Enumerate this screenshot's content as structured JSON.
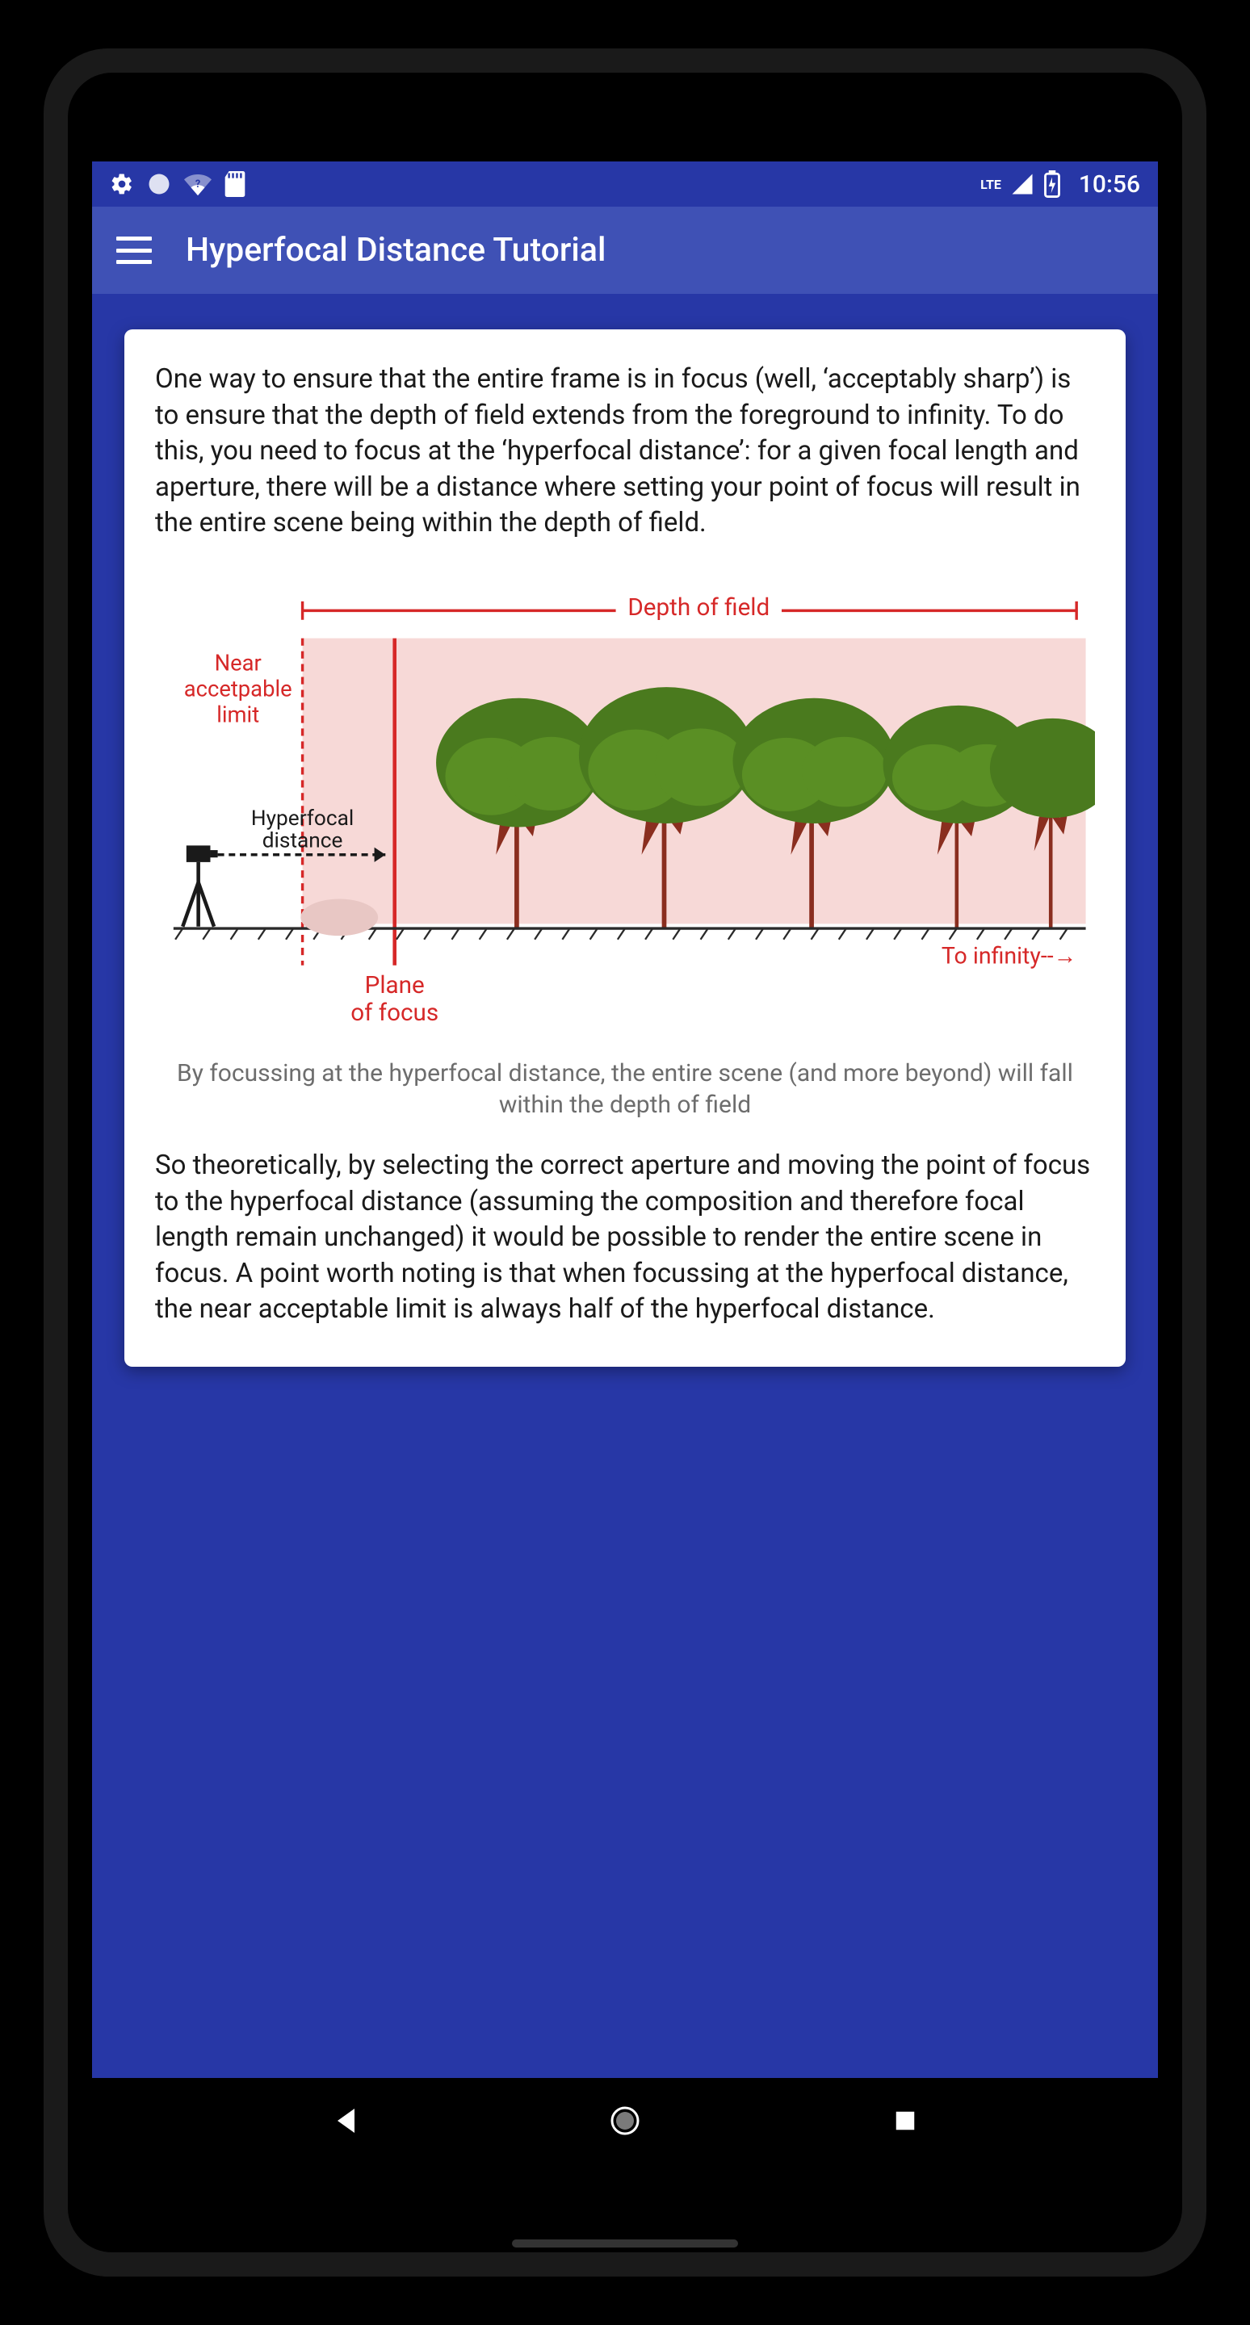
{
  "status": {
    "time": "10:56",
    "network_label": "LTE"
  },
  "appbar": {
    "title": "Hyperfocal Distance Tutorial"
  },
  "card": {
    "paragraph1": "One way to ensure that the entire frame is in focus (well, ‘acceptably sharp’) is to ensure that the depth of field extends from the foreground to infinity. To do this, you need to focus at the ‘hyperfocal distance’: for a given focal length and aperture, there will be a distance where setting your point of focus will result in the entire scene being within the depth of field.",
    "diagram": {
      "depth_of_field_label": "Depth of field",
      "near_limit_label_line1": "Near",
      "near_limit_label_line2": "accetpable",
      "near_limit_label_line3": "limit",
      "hyperfocal_label_line1": "Hyperfocal",
      "hyperfocal_label_line2": "distance",
      "plane_label_line1": "Plane",
      "plane_label_line2": "of focus",
      "to_infinity_label": "To infinity--→"
    },
    "caption": "By focussing at the hyperfocal distance, the entire scene (and more beyond) will fall within the depth of field",
    "paragraph2": "So theoretically, by selecting the correct aperture and moving the point of focus to the hyperfocal distance (assuming the composition and therefore focal length remain unchanged) it would be possible to render the entire scene in focus. A point worth noting is that when focussing at the hyperfocal distance, the near acceptable limit is always half of the hyperfocal distance."
  }
}
